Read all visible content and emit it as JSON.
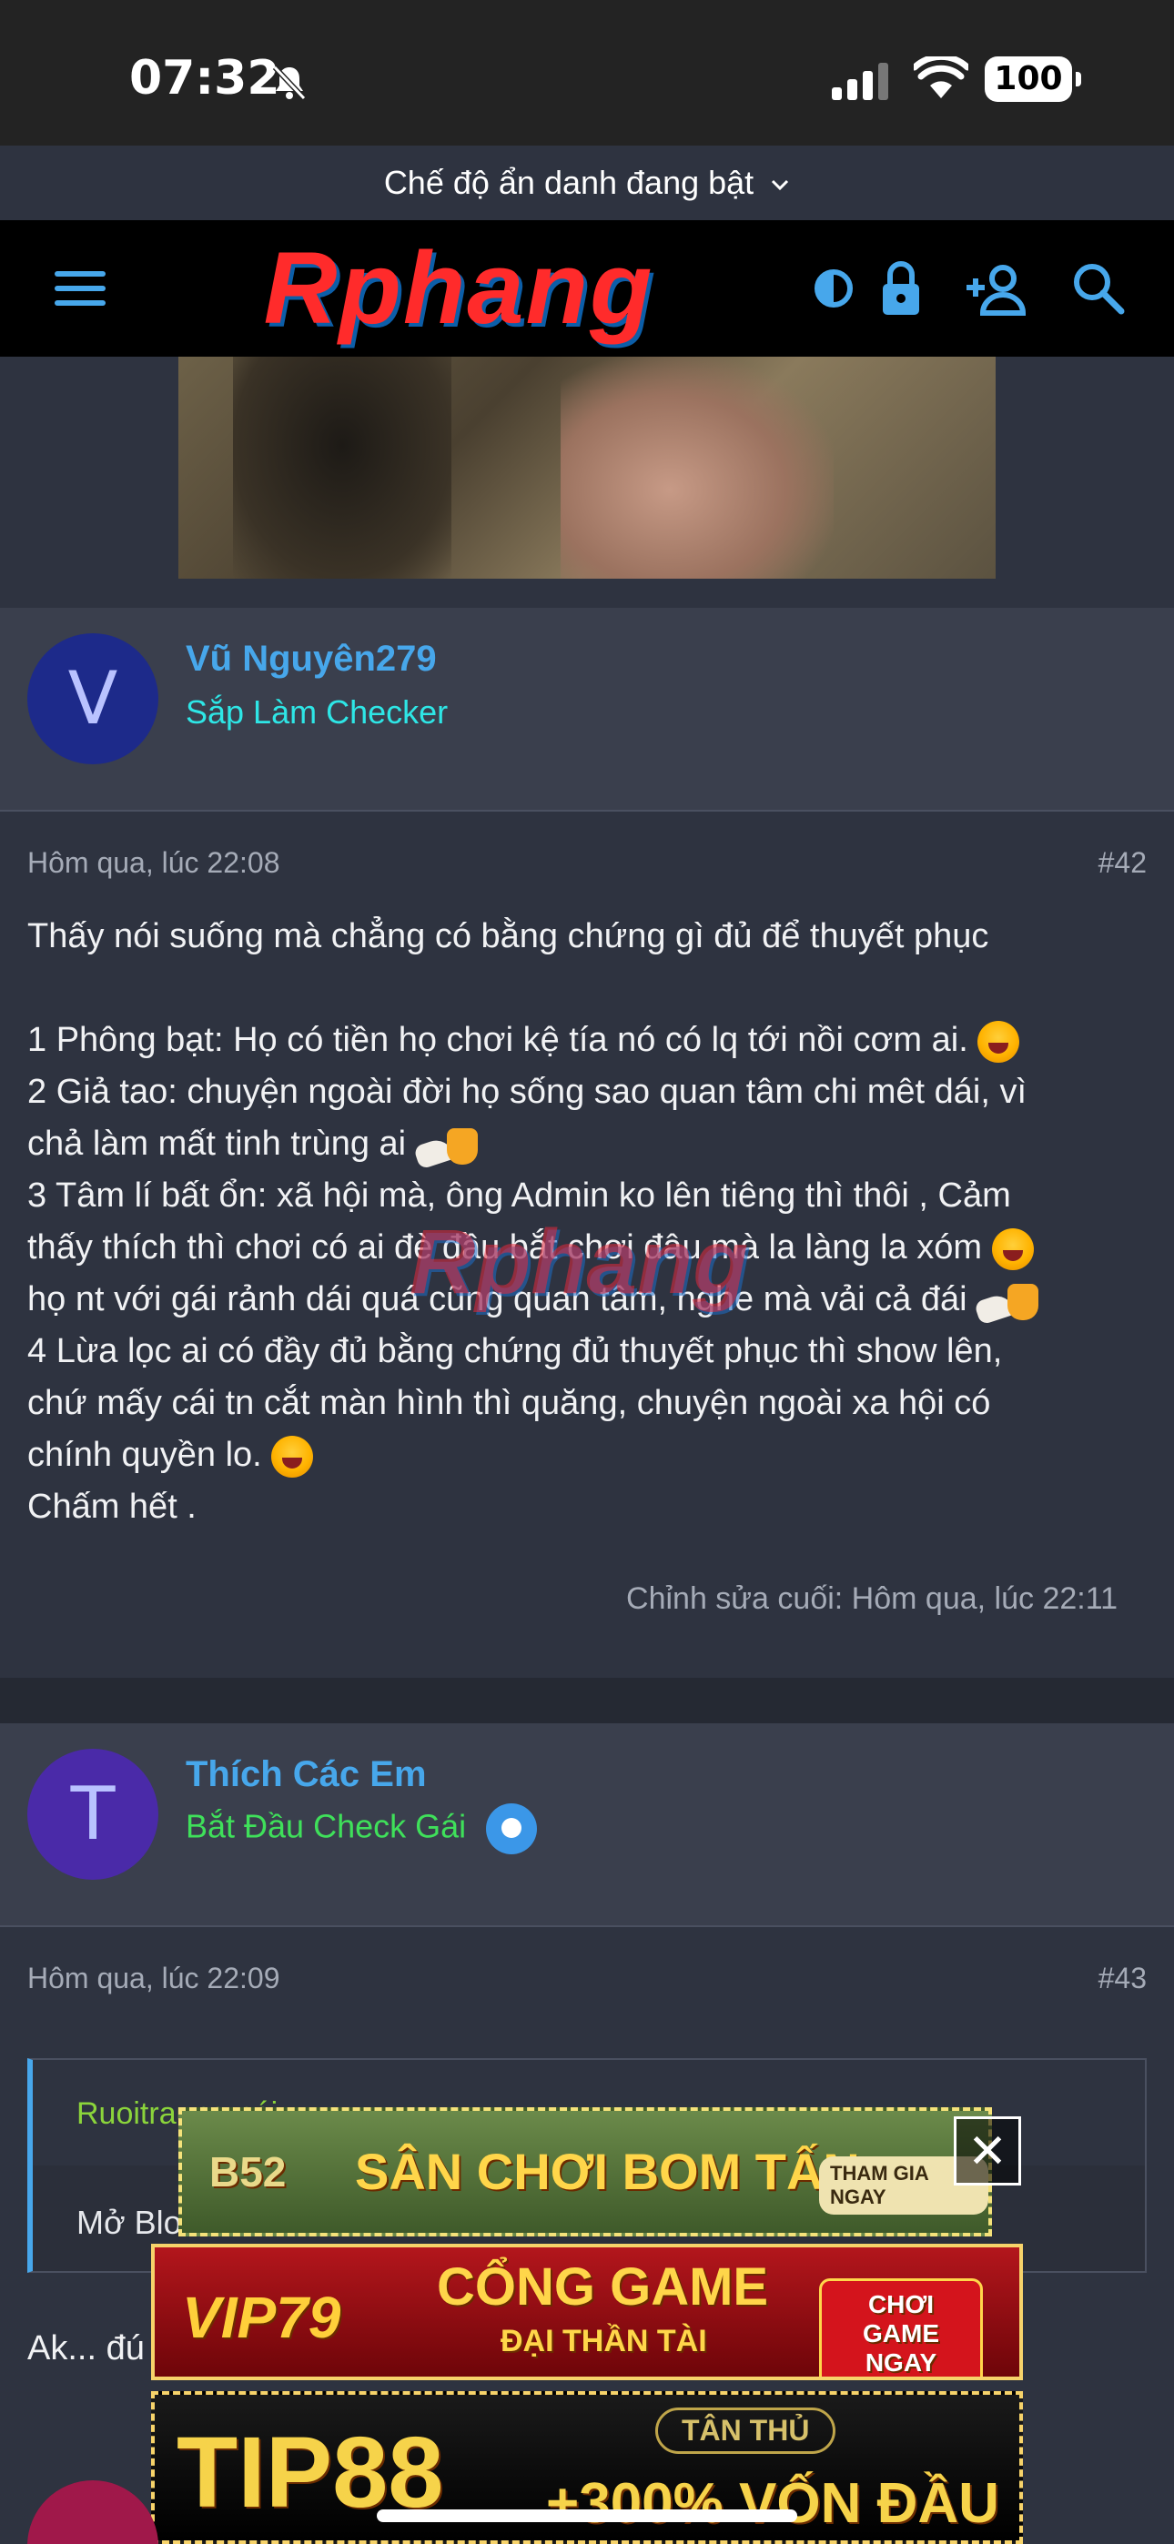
{
  "status": {
    "time": "07:32",
    "battery": "100"
  },
  "incognito_banner": "Chế độ ẩn danh đang bật",
  "header": {
    "logo_text": "Rphang",
    "watermark": "Rphang"
  },
  "posts": [
    {
      "avatar_letter": "V",
      "avatar_color": "#1d2a8a",
      "username": "Vũ Nguyên279",
      "user_title": "Sắp Làm Checker",
      "user_title_color": "#2ee6e6",
      "timestamp": "Hôm qua, lúc 22:08",
      "post_number": "#42",
      "lines": [
        "Thấy nói suống mà chẳng có bằng chứng gì đủ để thuyết phục",
        "1 Phông bạt: Họ có tiền họ chơi kệ tía nó có lq tới nồi cơm ai.",
        "2 Giả tao: chuyện ngoài đời họ sống sao quan tâm chi mêt dái, vì",
        "chả làm mất tinh trùng ai",
        "3 Tâm lí bất ổn: xã hội mà, ông Admin ko lên tiêng thì thôi , Cảm",
        "thấy thích thì chơi có ai đè đầu bắt chơi đâu mà la làng la xóm",
        "họ nt với gái rảnh dái quá cũng quan tâm, nghe mà vải cả đái",
        "4 Lừa lọc ai có đầy đủ bằng chứng đủ thuyết phục thì show lên,",
        "chứ mấy cái tn cắt màn hình thì quăng, chuyện ngoài xa hội có",
        "chính quyền lo.",
        "Chấm hết ."
      ],
      "edited": "Chỉnh sửa cuối: Hôm qua, lúc 22:11"
    },
    {
      "avatar_letter": "T",
      "avatar_color": "#4a2aa8",
      "username": "Thích Các Em",
      "user_title": "Bắt Đầu Check Gái",
      "user_title_color": "#3fe05a",
      "timestamp": "Hôm qua, lúc 22:09",
      "post_number": "#43",
      "quote_author": "Ruoitraung nói:",
      "quote_text": "Mở Blo",
      "reply_text": "Ak... đú"
    }
  ],
  "ads": {
    "b52_text": "SÂN CHƠI BOM TẤN",
    "b52_brand": "B52",
    "b52_cta": "THAM GIA NGAY",
    "vip_brand": "VIP79",
    "vip_title": "CỔNG GAME",
    "vip_subtitle": "ĐẠI THẦN TÀI",
    "vip_cta": "CHƠI GAME NGAY",
    "tip_brand": "TIP88",
    "tip_badge": "TÂN THỦ",
    "tip_offer": "+300% VỐN ĐẦU",
    "close_label": "✕"
  }
}
